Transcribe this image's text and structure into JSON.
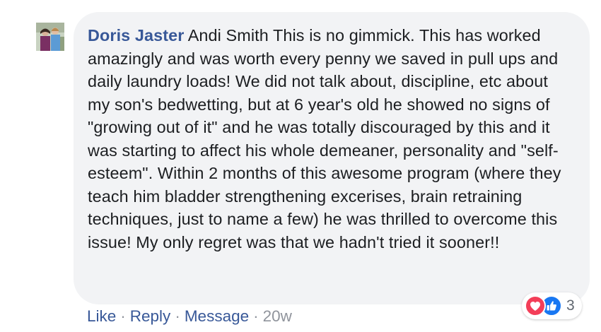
{
  "comment": {
    "author": "Doris Jaster",
    "text": "Andi Smith This is no gimmick. This has worked amazingly and was worth every penny we saved in pull ups and daily laundry loads! We did not talk about, discipline, etc about my son's bedwetting, but at 6 year's old he showed no signs of \"growing out of it\" and he was totally discouraged by this and it was starting to affect his whole demeaner, personality and \"self-esteem\". Within 2 months of this awesome program (where they teach him bladder strengthening excerises, brain retraining techniques, just to name a few) he was thrilled to overcome this issue! My only regret was that we hadn't tried it sooner!!"
  },
  "reactions": {
    "icons": [
      "love-icon",
      "like-icon"
    ],
    "count": "3"
  },
  "actions": {
    "like": "Like",
    "reply": "Reply",
    "message": "Message",
    "separator": "·",
    "timestamp": "20w"
  },
  "colors": {
    "bubble_bg": "#f2f3f5",
    "link": "#385898",
    "love": "#f33e58",
    "like": "#1877f2",
    "muted": "#90949c"
  }
}
